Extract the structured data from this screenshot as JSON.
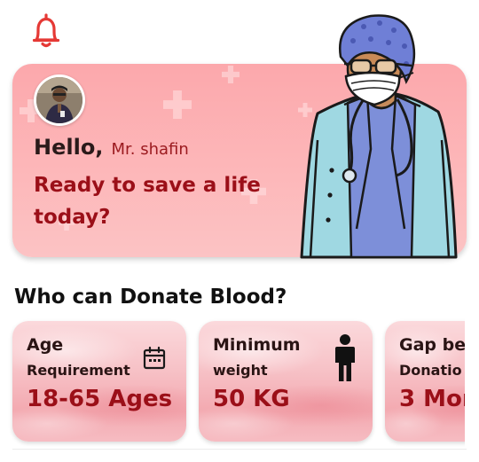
{
  "header": {
    "notification_icon": "bell-icon",
    "accent": "#e53935"
  },
  "hero": {
    "hello": "Hello,",
    "user_name": "Mr. shafin",
    "tagline": "Ready to save a life today?",
    "avatar_icon": "user-avatar",
    "illustration": "doctor-illustration"
  },
  "section": {
    "title": "Who can Donate Blood?"
  },
  "cards": [
    {
      "title": "Age",
      "subtitle": "Requirement",
      "value": "18-65 Ages",
      "icon": "calendar-icon"
    },
    {
      "title": "Minimum",
      "subtitle": "weight",
      "value": "50 KG",
      "icon": "person-icon"
    },
    {
      "title": "Gap be",
      "subtitle": "Donatio",
      "value": "3 Mor",
      "icon": ""
    }
  ],
  "colors": {
    "brand_red": "#9b0f18",
    "card_pink": "#f7c2c7",
    "hero_pink": "#fca8ac"
  }
}
